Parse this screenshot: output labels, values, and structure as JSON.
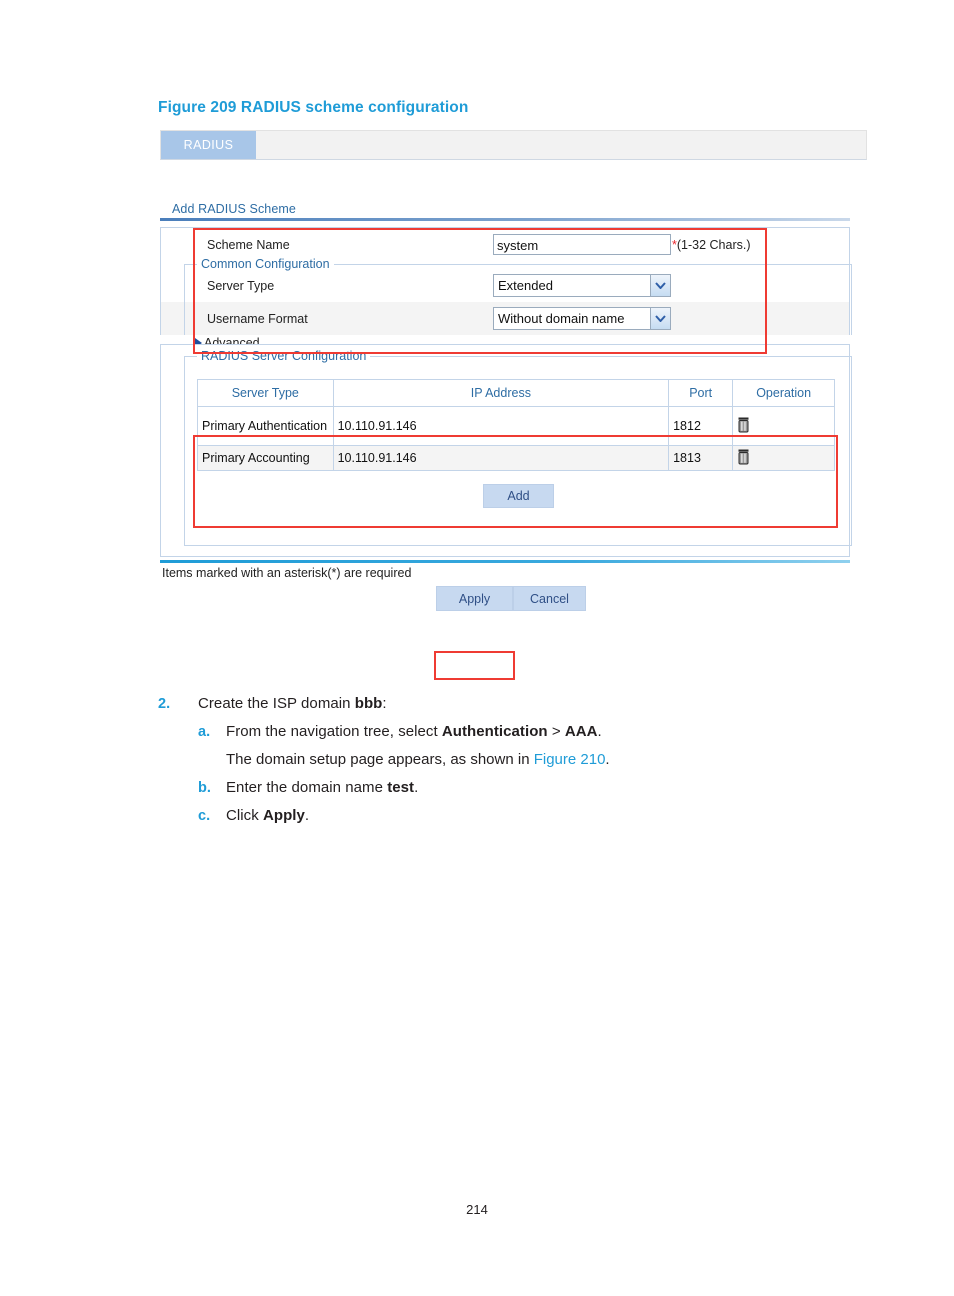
{
  "figure": {
    "caption": "Figure 209 RADIUS scheme configuration"
  },
  "screenshot": {
    "tab": {
      "label": "RADIUS"
    },
    "section": {
      "title": "Add RADIUS Scheme"
    },
    "form": {
      "scheme_name": {
        "label": "Scheme Name",
        "value": "system",
        "hint_star": "*",
        "hint_text": "(1-32 Chars.)"
      },
      "common_configuration": {
        "legend": "Common Configuration",
        "server_type": {
          "label": "Server Type",
          "value": "Extended"
        },
        "username_format": {
          "label": "Username Format",
          "value": "Without domain name"
        }
      },
      "advanced": {
        "label": "Advanced"
      }
    },
    "server_config": {
      "legend": "RADIUS Server Configuration",
      "columns": [
        "Server Type",
        "IP Address",
        "Port",
        "Operation"
      ],
      "rows": [
        {
          "server_type": "Primary Authentication",
          "ip_address": "10.110.91.146",
          "port": "1812",
          "operation_icon": "delete-icon"
        },
        {
          "server_type": "Primary Accounting",
          "ip_address": "10.110.91.146",
          "port": "1813",
          "operation_icon": "delete-icon"
        }
      ],
      "add_button": "Add"
    },
    "required_note": "Items marked with an asterisk(*) are required",
    "buttons": {
      "apply": "Apply",
      "cancel": "Cancel"
    },
    "colors": {
      "tab_bg": "#a8c6e8",
      "section_title": "#2e6da4",
      "button_bg": "#c7d9f0",
      "annotation_red": "#ef3b33",
      "required_star": "#e8262d"
    }
  },
  "steps": {
    "step2": {
      "num": "2.",
      "text_before": "Create the ISP domain ",
      "bold": "bbb",
      "text_after": ":"
    },
    "a": {
      "num": "a.",
      "t1": "From the navigation tree, select ",
      "b1": "Authentication",
      "t2": " > ",
      "b2": "AAA",
      "t3": "."
    },
    "a_cont": {
      "t1": "The domain setup page appears, as shown in ",
      "link": "Figure 210",
      "t2": "."
    },
    "b": {
      "num": "b.",
      "t1": "Enter the domain name ",
      "b1": "test",
      "t2": "."
    },
    "c": {
      "num": "c.",
      "t1": "Click ",
      "b1": "Apply",
      "t2": "."
    }
  },
  "page": {
    "number": "214"
  }
}
